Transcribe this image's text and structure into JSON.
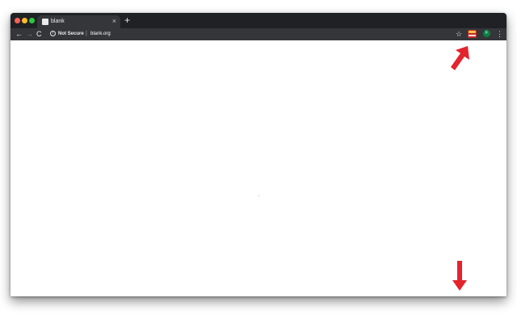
{
  "browser": {
    "tab": {
      "title": "blank",
      "close_glyph": "×",
      "favicon": "page-icon"
    },
    "new_tab_glyph": "+",
    "toolbar": {
      "back_glyph": "←",
      "forward_glyph": "→",
      "reload_glyph": "C",
      "info_glyph": "i",
      "security_label": "Not Secure",
      "separator": "|",
      "url": "blank.org",
      "bookmark_glyph": "☆",
      "profile_initial": "F",
      "menu_glyph": "⋮"
    }
  },
  "colors": {
    "tabstrip": "#202124",
    "toolbar": "#35363a",
    "annotation_arrow": "#e3232d",
    "extension_icon": "#c62828",
    "profile_avatar": "#0b8043"
  },
  "icons": [
    "close-dot",
    "minimize-dot",
    "maximize-dot",
    "page-icon",
    "close-icon",
    "plus-icon",
    "back-arrow-icon",
    "forward-arrow-icon",
    "reload-icon",
    "info-icon",
    "star-icon",
    "extension-icon",
    "avatar",
    "kebab-menu-icon",
    "red-arrow-annotation"
  ]
}
